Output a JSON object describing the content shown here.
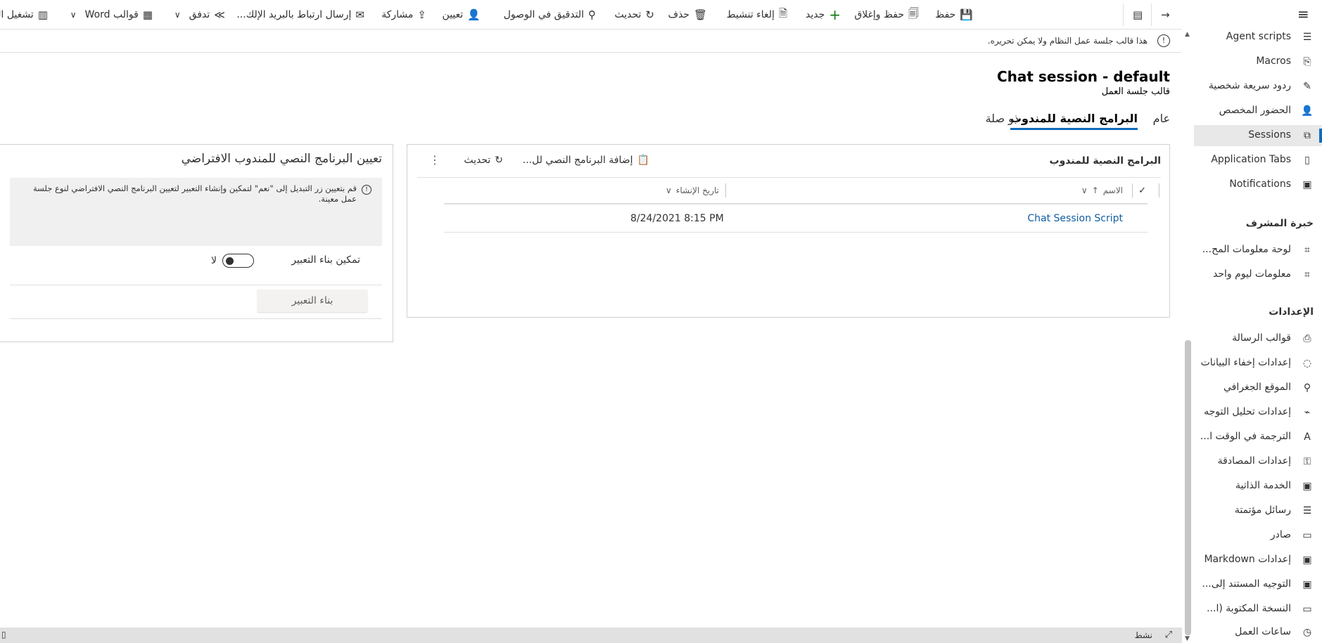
{
  "commandbar": {
    "back": "→",
    "items": [
      {
        "label": "حفظ",
        "icon": "save-icon"
      },
      {
        "label": "حفظ وإغلاق",
        "icon": "save-close-icon"
      },
      {
        "label": "جديد",
        "icon": "add-icon"
      },
      {
        "label": "إلغاء تنشيط",
        "icon": "deactivate-icon"
      },
      {
        "label": "حذف",
        "icon": "delete-icon"
      },
      {
        "label": "تحديث",
        "icon": "refresh-icon"
      },
      {
        "label": "التدقيق في الوصول",
        "icon": "check-access-icon"
      },
      {
        "label": "تعيين",
        "icon": "assign-icon"
      },
      {
        "label": "مشاركة",
        "icon": "share-icon"
      },
      {
        "label": "إرسال ارتباط بالبريد الإلك...",
        "icon": "email-link-icon"
      },
      {
        "label": "تدفق",
        "icon": "flow-icon"
      },
      {
        "label": "قوالب Word",
        "icon": "word-templates-icon"
      },
      {
        "label": "تشغيل التقرير",
        "icon": "report-icon"
      }
    ]
  },
  "notification": {
    "text": "هذا قالب جلسة عمل النظام ولا يمكن تحريره.",
    "icon": "info-icon"
  },
  "record": {
    "title": "Chat session - default",
    "subtitle": "قالب جلسة العمل"
  },
  "tabs": [
    {
      "label": "عام"
    },
    {
      "label": "البرامج النصية للمندوب",
      "active": true
    },
    {
      "label": "ذو صلة"
    }
  ],
  "scripts_panel": {
    "title": "البرامج النصية للمندوب",
    "add_label": "إضافة البرنامج النصي لل...",
    "refresh_label": "تحديث",
    "more": "⋮",
    "columns": {
      "check": "✓",
      "name": "الاسم",
      "name_sort": "↑",
      "created": "تاريخ الإنشاء"
    },
    "rows": [
      {
        "name": "Chat Session Script",
        "created": "8/24/2021 8:15 PM"
      }
    ]
  },
  "default_panel": {
    "title": "تعيين البرنامج النصي للمندوب الافتراضي",
    "info": "قم بتعيين زر التبديل إلى \"نعم\" لتمكين وإنشاء التعبير لتعيين البرنامج النصي الافتراضي لنوع جلسة عمل معينة.",
    "enable_label": "تمكين بناء التعبير",
    "toggle_value": "لا",
    "toggle_on": false,
    "build_label": "بناء التعبير"
  },
  "nav": {
    "items_top": [
      {
        "label": "Agent scripts",
        "icon": "agent-scripts-icon"
      },
      {
        "label": "Macros",
        "icon": "macros-icon"
      },
      {
        "label": "ردود سريعة شخصية",
        "icon": "quick-replies-icon"
      },
      {
        "label": "الحضور المخصص",
        "icon": "presence-icon"
      },
      {
        "label": "Sessions",
        "icon": "sessions-icon",
        "selected": true
      },
      {
        "label": "Application Tabs",
        "icon": "application-tabs-icon"
      },
      {
        "label": "Notifications",
        "icon": "notifications-icon"
      }
    ],
    "section_supervisor": "خبرة المشرف",
    "items_supervisor": [
      {
        "label": "لوحة معلومات المح...",
        "icon": "dashboard-icon"
      },
      {
        "label": "معلومات ليوم واحد",
        "icon": "intraday-icon"
      }
    ],
    "section_settings": "الإعدادات",
    "items_settings": [
      {
        "label": "قوالب الرسالة",
        "icon": "message-templates-icon"
      },
      {
        "label": "إعدادات إخفاء البيانات",
        "icon": "data-masking-icon"
      },
      {
        "label": "الموقع الجغرافي",
        "icon": "geo-location-icon"
      },
      {
        "label": "إعدادات تحليل التوجه",
        "icon": "sentiment-icon"
      },
      {
        "label": "الترجمة في الوقت ا...",
        "icon": "translation-icon"
      },
      {
        "label": "إعدادات المصادقة",
        "icon": "authentication-icon"
      },
      {
        "label": "الخدمة الذاتية",
        "icon": "self-service-icon"
      },
      {
        "label": "رسائل مؤتمتة",
        "icon": "automated-messages-icon"
      },
      {
        "label": "صادر",
        "icon": "outbound-icon"
      },
      {
        "label": "إعدادات Markdown",
        "icon": "markdown-icon"
      },
      {
        "label": "التوجيه المستند إلى...",
        "icon": "routing-icon"
      },
      {
        "label": "النسخة المكتوبة (ا...",
        "icon": "transcript-icon"
      },
      {
        "label": "ساعات العمل",
        "icon": "operating-hours-icon"
      }
    ]
  },
  "statusbar": {
    "text": "نشط",
    "icon": "open-window-icon"
  }
}
